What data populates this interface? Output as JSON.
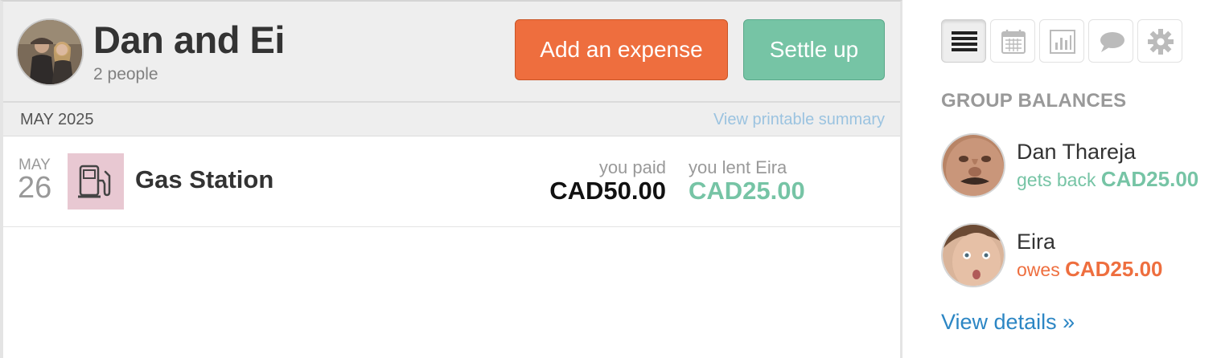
{
  "group": {
    "name": "Dan and Ei",
    "subtitle": "2 people"
  },
  "actions": {
    "add_expense": "Add an expense",
    "settle_up": "Settle up"
  },
  "month_bar": {
    "label": "MAY 2025",
    "printable_link": "View printable summary"
  },
  "expenses": [
    {
      "month": "MAY",
      "day": "26",
      "name": "Gas Station",
      "icon": "gas-pump-icon",
      "paid_label": "you paid",
      "paid_amount": "CAD50.00",
      "lent_label": "you lent Eira",
      "lent_amount": "CAD25.00"
    }
  ],
  "sidebar": {
    "view_tabs": [
      {
        "icon": "list-icon",
        "active": true
      },
      {
        "icon": "calendar-icon",
        "active": false
      },
      {
        "icon": "chart-icon",
        "active": false
      },
      {
        "icon": "chat-icon",
        "active": false
      },
      {
        "icon": "gear-icon",
        "active": false
      }
    ],
    "heading": "GROUP BALANCES",
    "members": [
      {
        "name": "Dan Thareja",
        "status": "gets back",
        "amount": "CAD25.00"
      },
      {
        "name": "Eira",
        "status": "owes",
        "amount": "CAD25.00"
      }
    ],
    "view_details": "View details »"
  },
  "colors": {
    "orange": "#ee6e3e",
    "teal": "#76c4a5",
    "link_blue": "#2c86c4",
    "header_gray": "#eeeeee"
  }
}
